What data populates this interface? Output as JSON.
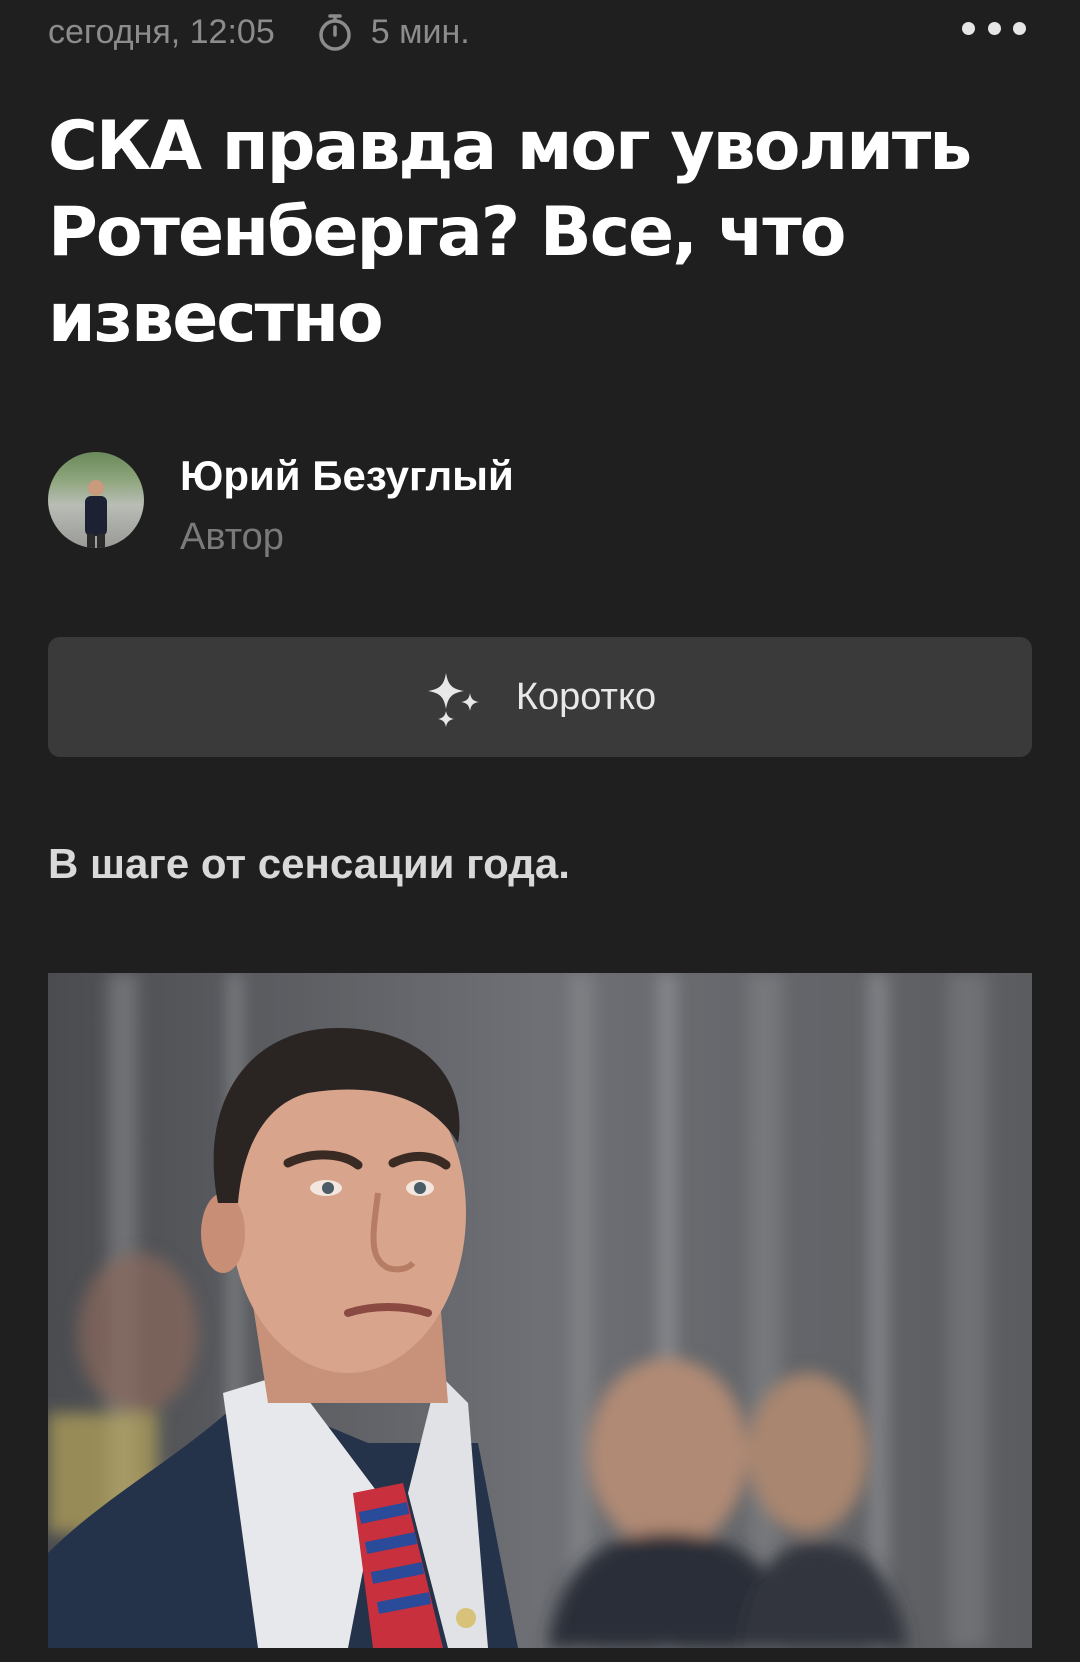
{
  "meta": {
    "date": "сегодня, 12:05",
    "read_time": "5 мин.",
    "timer_icon": "stopwatch-icon",
    "more_icon": "more-dots-icon"
  },
  "article": {
    "title": "СКА правда мог уволить Ротенберга? Все, что известно",
    "lead": "В шаге от сенсации года."
  },
  "author": {
    "name": "Юрий Безуглый",
    "role": "Автор"
  },
  "summary_button": {
    "label": "Коротко",
    "icon": "sparkle-icon"
  },
  "colors": {
    "background": "#1f1f1f",
    "button_bg": "#3a3a3a",
    "muted_text": "#8c8c8c"
  }
}
